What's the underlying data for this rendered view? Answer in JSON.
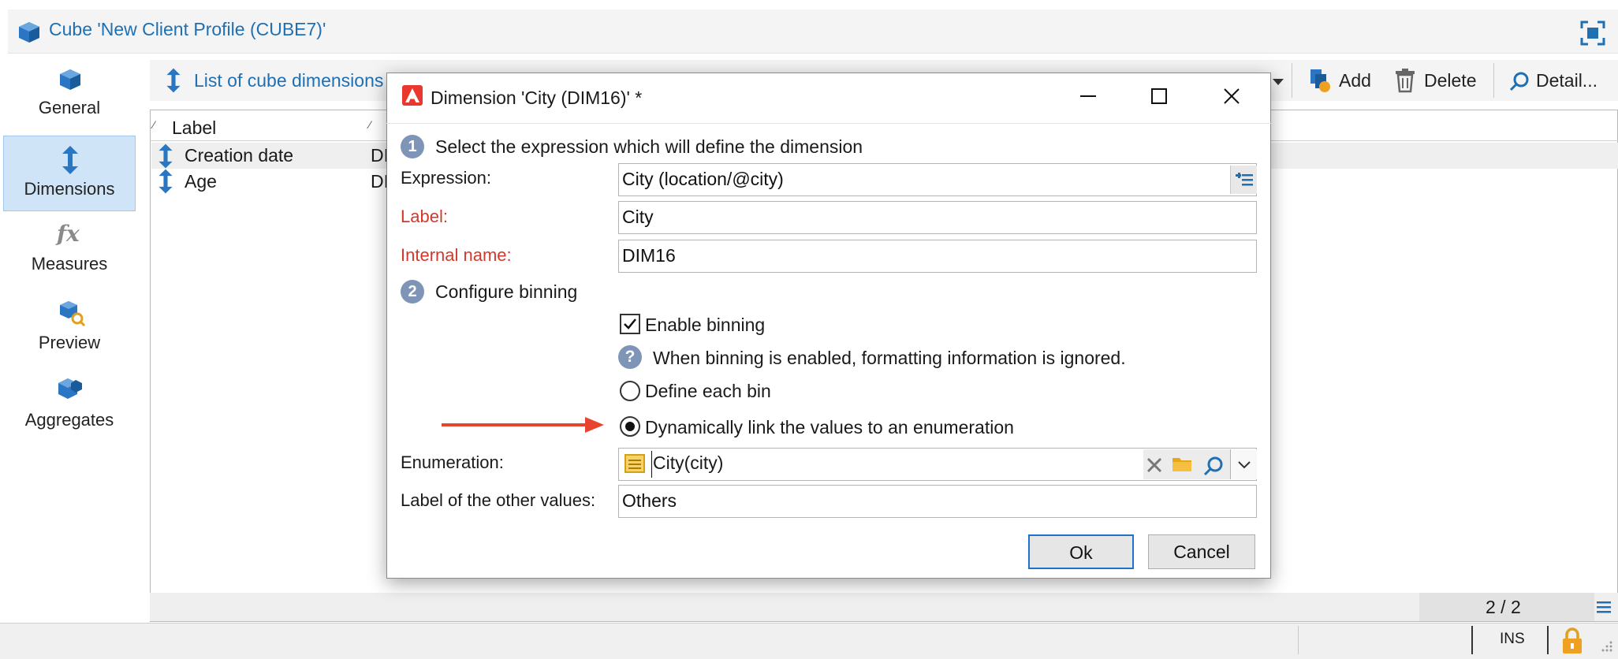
{
  "window": {
    "title": "Cube 'New Client Profile (CUBE7)'"
  },
  "nav": {
    "items": [
      {
        "label": "General",
        "icon": "cube-icon"
      },
      {
        "label": "Dimensions",
        "icon": "dimensions-arrow-icon",
        "selected": true
      },
      {
        "label": "Measures",
        "icon": "fx-icon"
      },
      {
        "label": "Preview",
        "icon": "preview-icon"
      },
      {
        "label": "Aggregates",
        "icon": "aggregates-icon"
      }
    ]
  },
  "toolbar": {
    "list_label": "List of cube dimensions",
    "add_label": "Add",
    "delete_label": "Delete",
    "detail_label": "Detail..."
  },
  "grid": {
    "column_label": "Label",
    "rows": [
      {
        "label": "Creation date",
        "col2": "DI"
      },
      {
        "label": "Age",
        "col2": "DI"
      }
    ],
    "count": "2 / 2"
  },
  "statusbar": {
    "mode": "INS"
  },
  "dialog": {
    "title": "Dimension 'City (DIM16)' *",
    "step1": {
      "number": "1",
      "text": "Select the expression which will define the dimension"
    },
    "expression_label": "Expression:",
    "expression_value": "City (location/@city)",
    "label_label": "Label:",
    "label_value": "City",
    "internal_name_label": "Internal name:",
    "internal_name_value": "DIM16",
    "step2": {
      "number": "2",
      "text": "Configure binning"
    },
    "enable_binning_label": "Enable binning",
    "enable_binning_checked": true,
    "info_text": "When binning is enabled, formatting information is ignored.",
    "define_each_bin_label": "Define each bin",
    "dynamic_link_label": "Dynamically link the values to an enumeration",
    "enumeration_label": "Enumeration:",
    "enumeration_value": "City(city)",
    "other_values_label": "Label of the other values:",
    "other_values_value": "Others",
    "ok_label": "Ok",
    "cancel_label": "Cancel"
  },
  "colors": {
    "accent": "#1f6fb3",
    "required": "#d03a2c",
    "arrow": "#e8432f",
    "adobe_red": "#e9382e"
  }
}
